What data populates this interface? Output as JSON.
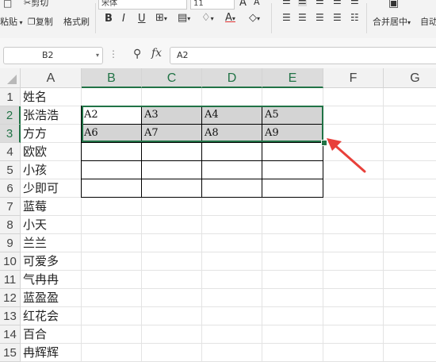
{
  "toolbar": {
    "cut_label": "剪切",
    "paste_label": "粘贴",
    "copy_label": "复制",
    "format_painter_label": "格式刷",
    "font_name": "宋体",
    "font_size": "11",
    "bold": "B",
    "italic": "I",
    "underline": "U",
    "grow_font": "A",
    "shrink_font": "A",
    "merge_center_label": "合并居中",
    "wrap_label": "自动"
  },
  "formula_bar": {
    "cell_ref": "B2",
    "formula": "A2"
  },
  "sheet": {
    "columns": [
      "A",
      "B",
      "C",
      "D",
      "E",
      "F",
      "G"
    ],
    "selected_columns": [
      "B",
      "C",
      "D",
      "E"
    ],
    "rows": [
      "1",
      "2",
      "3",
      "4",
      "5",
      "6",
      "7",
      "8",
      "9",
      "10",
      "11",
      "12",
      "13",
      "14",
      "15"
    ],
    "selected_rows": [
      "2",
      "3"
    ],
    "column_a": [
      "姓名",
      "张浩浩",
      "方方",
      "欧欧",
      "小孩",
      "少即可",
      "蓝莓",
      "小天",
      "兰兰",
      "可爱多",
      "气冉冉",
      "蓝盈盈",
      "红花会",
      "百合",
      "冉辉辉"
    ],
    "table": [
      [
        "A2",
        "A3",
        "A4",
        "A5"
      ],
      [
        "A6",
        "A7",
        "A8",
        "A9"
      ],
      [
        "",
        "",
        "",
        ""
      ],
      [
        "",
        "",
        "",
        ""
      ],
      [
        "",
        "",
        "",
        ""
      ]
    ]
  },
  "colors": {
    "accent_green": "#217346",
    "selection_gray": "#d4d4d4",
    "arrow_red": "#e8403a"
  }
}
